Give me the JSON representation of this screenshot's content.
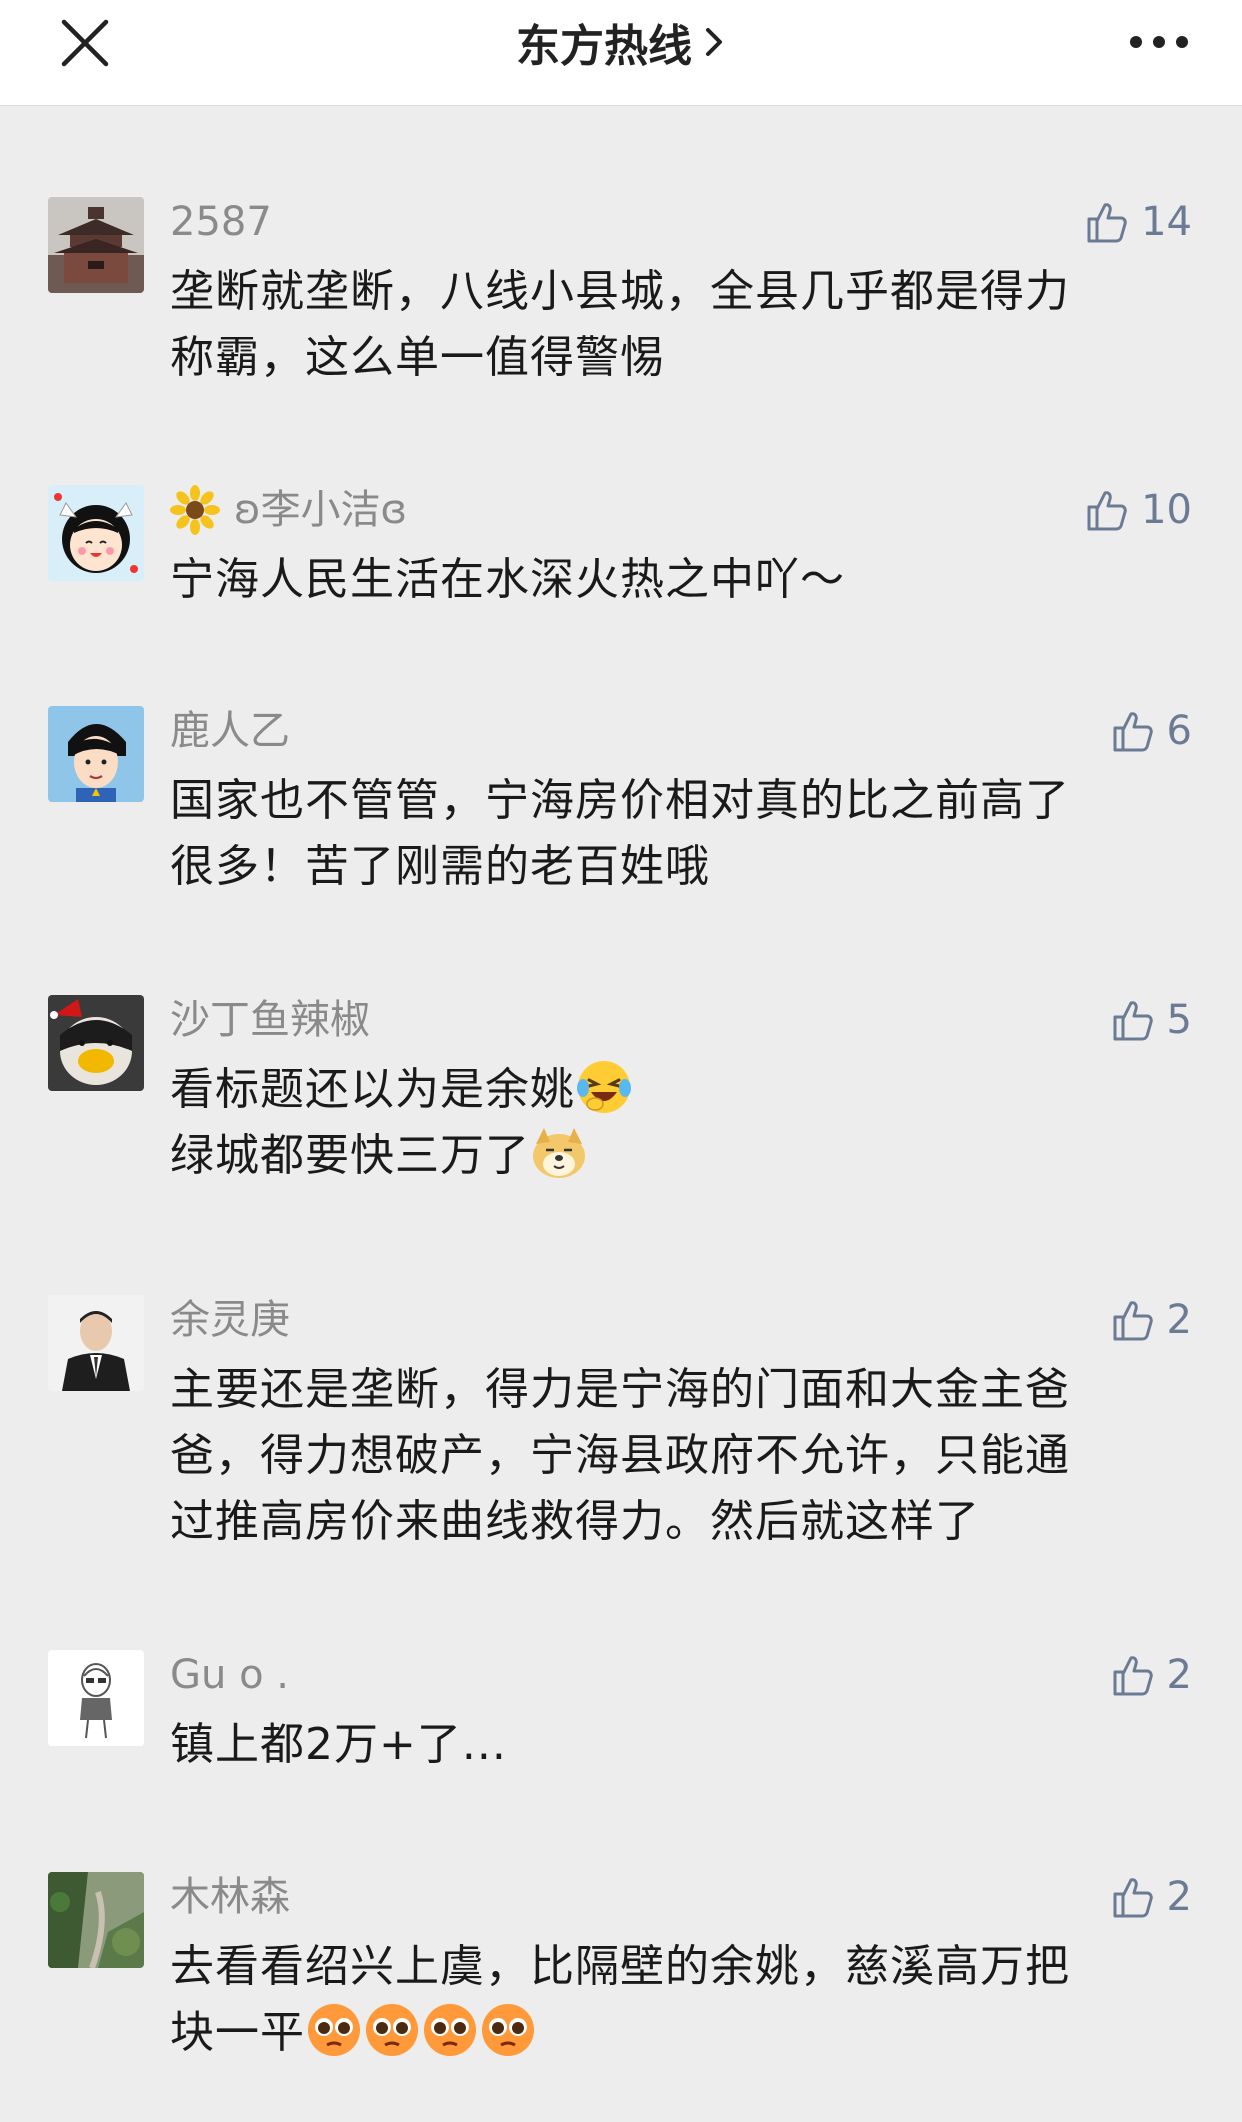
{
  "header": {
    "title": "东方热线",
    "close_icon": "close-icon",
    "more_icon": "more-dots-icon"
  },
  "comments": [
    {
      "nickname": "2587",
      "likes": "14",
      "lines": [
        "垄断就垄断，八线小县城，全县几乎都是得力",
        "称霸，这么单一值得警惕"
      ]
    },
    {
      "nickname": "ʚ李小洁ɞ",
      "nickname_icon": "sunflower-icon",
      "likes": "10",
      "lines": [
        "宁海人民生活在水深火热之中吖～"
      ]
    },
    {
      "nickname": "鹿人乙",
      "likes": "6",
      "lines": [
        "国家也不管管，宁海房价相对真的比之前高了",
        "很多！苦了刚需的老百姓哦"
      ]
    },
    {
      "nickname": "沙丁鱼辣椒",
      "likes": "5",
      "lines": [
        "看标题还以为是余姚",
        "绿城都要快三万了"
      ],
      "emojis": [
        "laughing-crying-emoji",
        "doge-emoji"
      ]
    },
    {
      "nickname": "余灵庚",
      "likes": "2",
      "lines": [
        "主要还是垄断，得力是宁海的门面和大金主爸",
        "爸，得力想破产，宁海县政府不允许，只能通",
        "过推高房价来曲线救得力。然后就这样了"
      ]
    },
    {
      "nickname": "Gu o .",
      "likes": "2",
      "lines": [
        "镇上都2万+了..."
      ]
    },
    {
      "nickname": "木林森",
      "likes": "2",
      "lines": [
        "去看看绍兴上虞，比隔壁的余姚，慈溪高万把",
        "块一平"
      ],
      "emojis": [
        "pleading-face-emoji",
        "pleading-face-emoji",
        "pleading-face-emoji",
        "pleading-face-emoji"
      ]
    }
  ],
  "colors": {
    "background": "#ededed",
    "nickname": "#8a8a8a",
    "like_icon": "#6b7b94",
    "text": "#1a1a1a"
  }
}
